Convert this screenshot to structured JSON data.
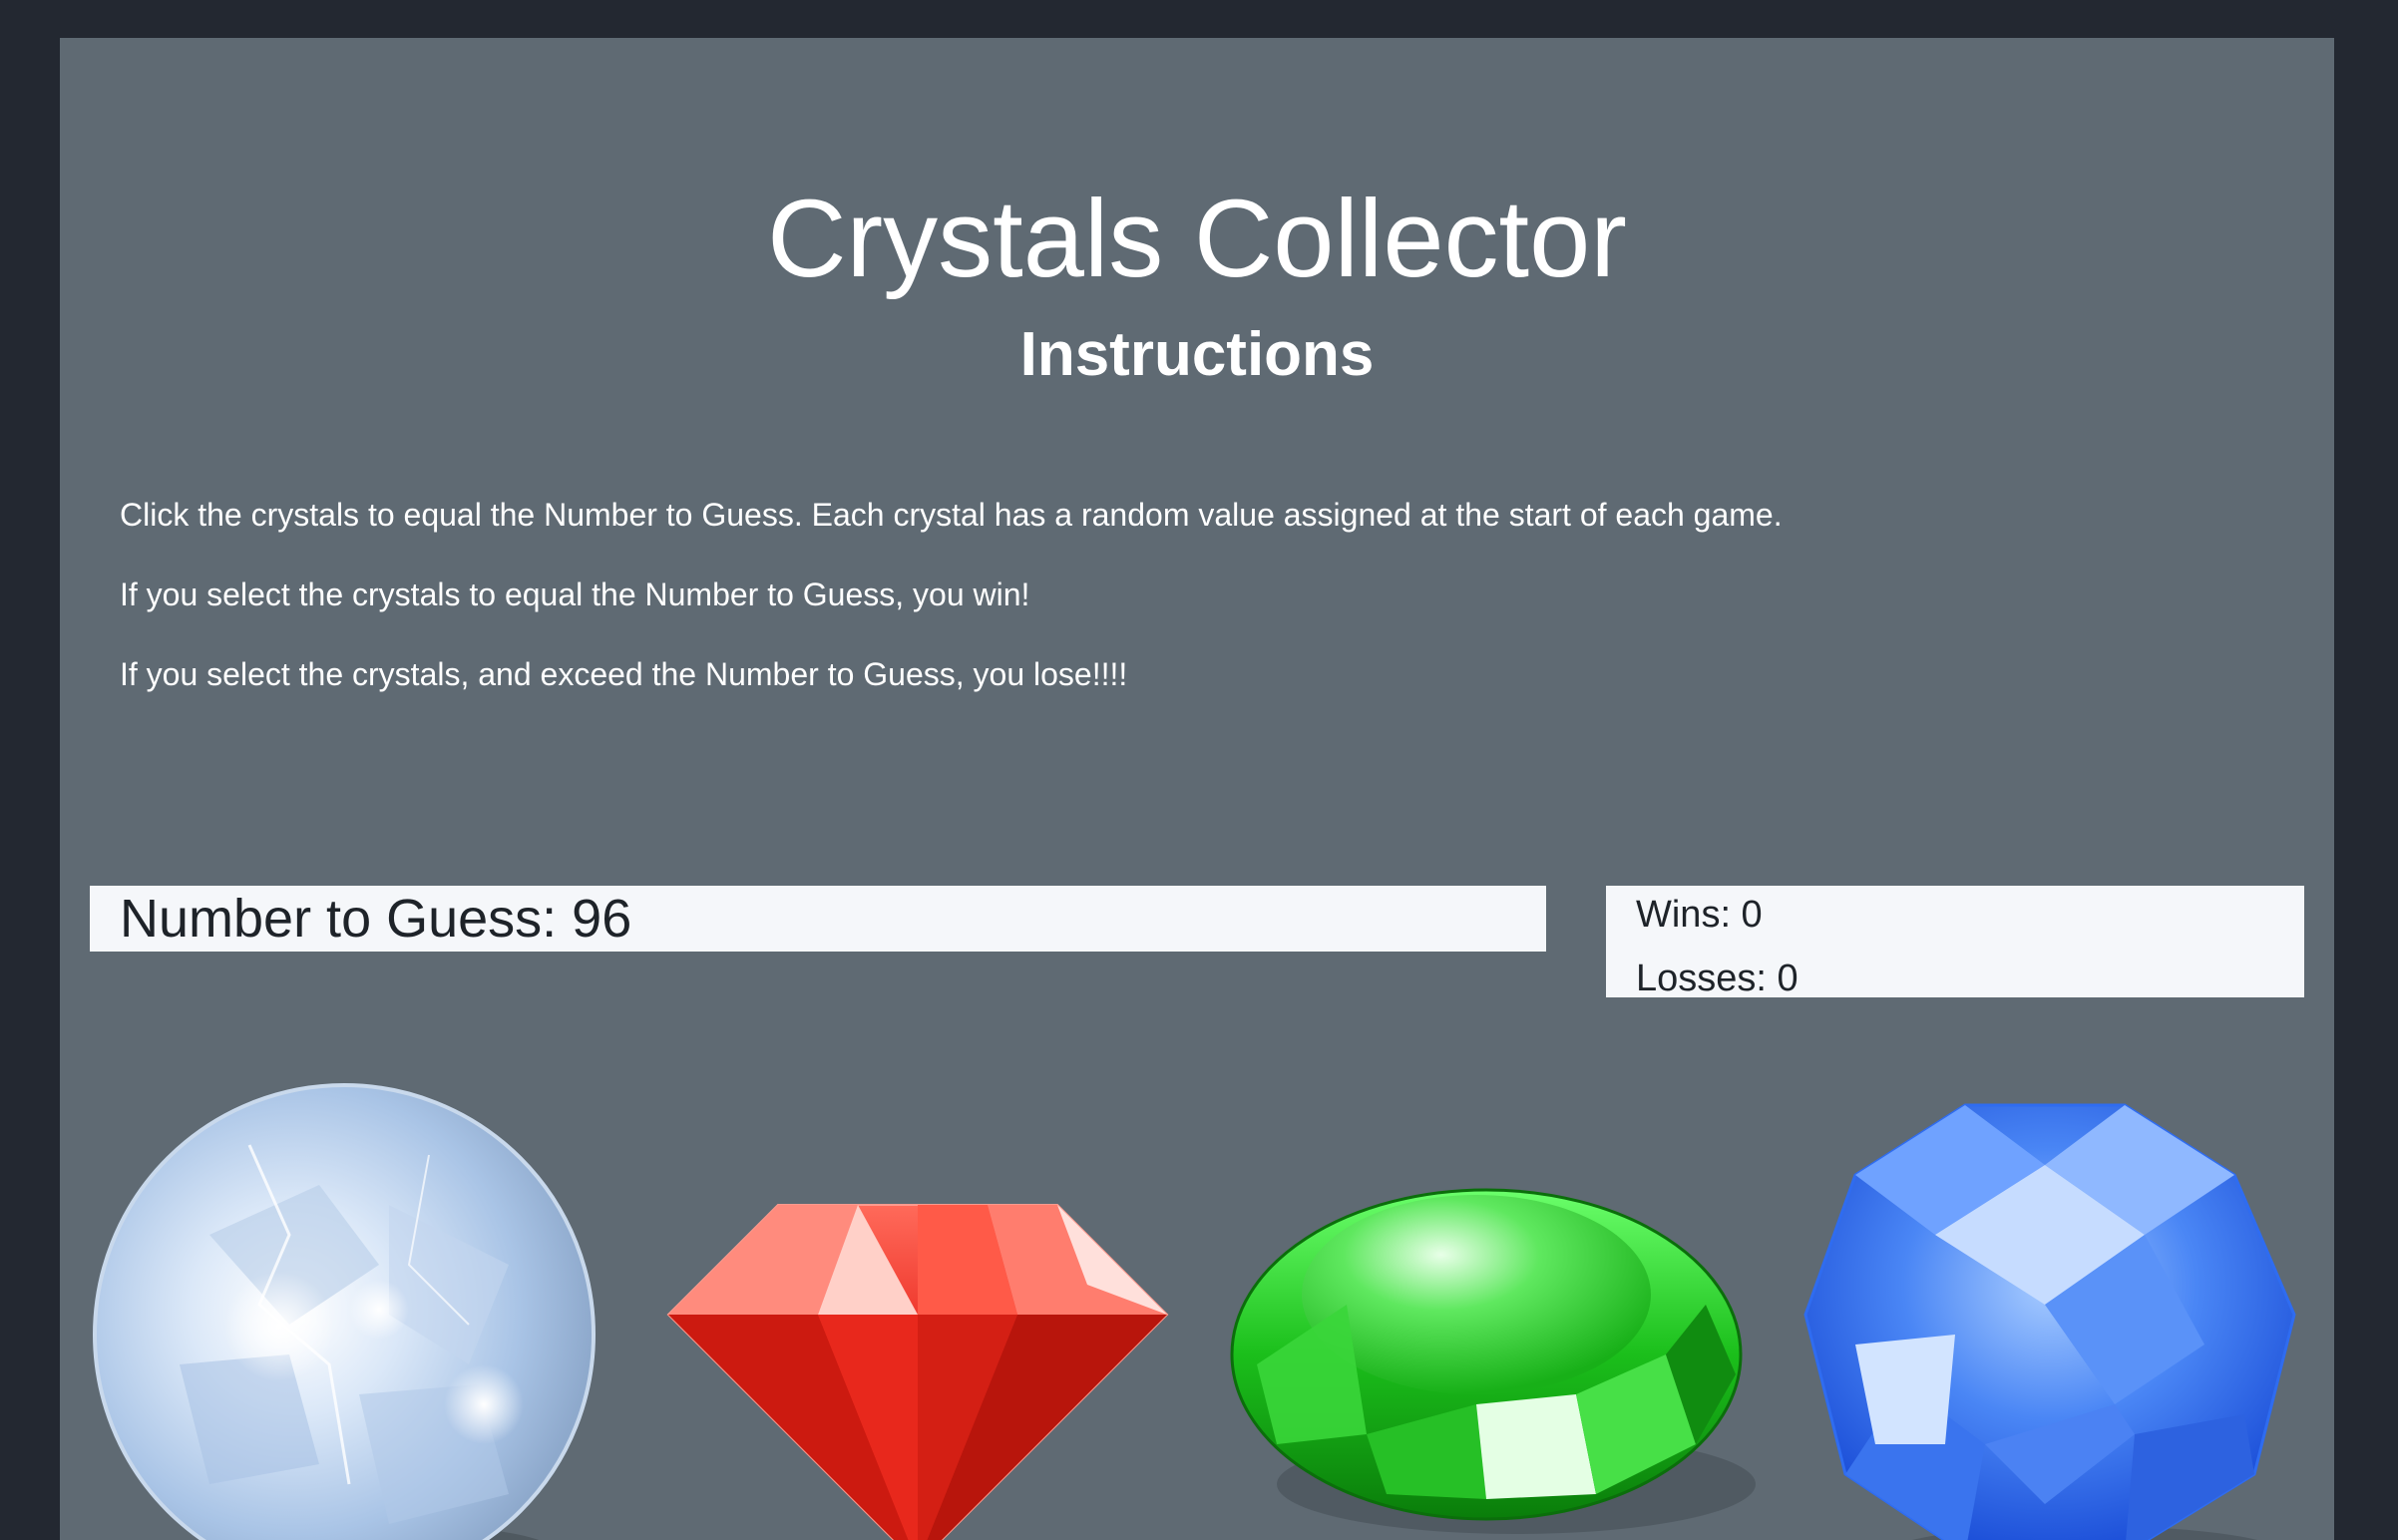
{
  "header": {
    "title": "Crystals Collector",
    "subtitle": "Instructions"
  },
  "instructions": [
    "Click the crystals to equal the Number to Guess. Each crystal has a random value assigned at the start of each game.",
    "If you select the crystals to equal the Number to Guess, you win!",
    "If you select the crystals, and exceed the Number to Guess, you lose!!!!"
  ],
  "game": {
    "number_to_guess_label": "Number to Guess: 96",
    "wins_label": "Wins: 0",
    "losses_label": "Losses: 0"
  },
  "crystals": [
    {
      "name": "white-crystal-icon",
      "color": "#cfe0f5"
    },
    {
      "name": "red-crystal-icon",
      "color": "#e8231a"
    },
    {
      "name": "green-crystal-icon",
      "color": "#1bbf1b"
    },
    {
      "name": "blue-crystal-icon",
      "color": "#2f6cf0"
    }
  ],
  "colors": {
    "background": "#232831",
    "panel": "#5f6a73",
    "box": "#f5f7fa",
    "text_light": "#ffffff",
    "text_dark": "#1e2329"
  }
}
